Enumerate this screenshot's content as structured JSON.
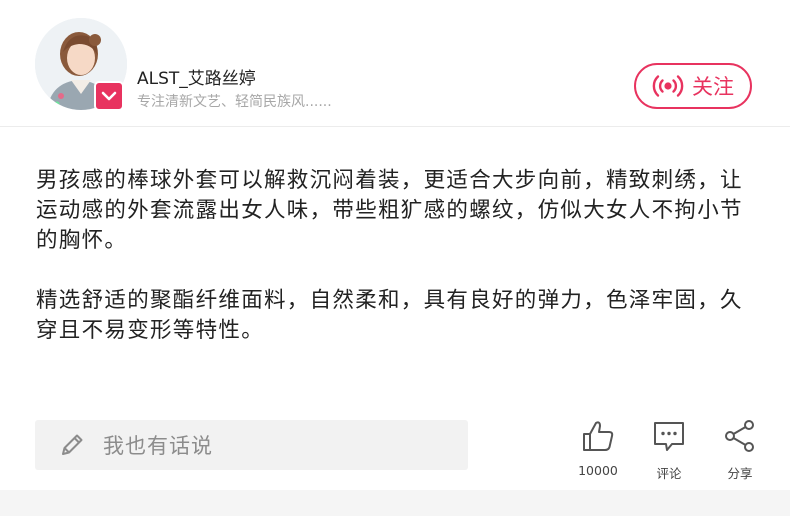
{
  "header": {
    "username": "ALST_艾路丝婷",
    "bio": "专注清新文艺、轻简民族风......",
    "follow_label": "关注",
    "accent_color": "#e8335f"
  },
  "post": {
    "paragraphs": [
      "男孩感的棒球外套可以解救沉闷着装，更适合大步向前，精致刺绣，让运动感的外套流露出女人味，带些粗犷感的螺纹，仿似大女人不拘小节的胸怀。",
      "精选舒适的聚酯纤维面料，自然柔和，具有良好的弹力，色泽牢固，久穿且不易变形等特性。"
    ]
  },
  "footer": {
    "comment_placeholder": "我也有话说",
    "like_count": "10000",
    "comment_label": "评论",
    "share_label": "分享"
  }
}
